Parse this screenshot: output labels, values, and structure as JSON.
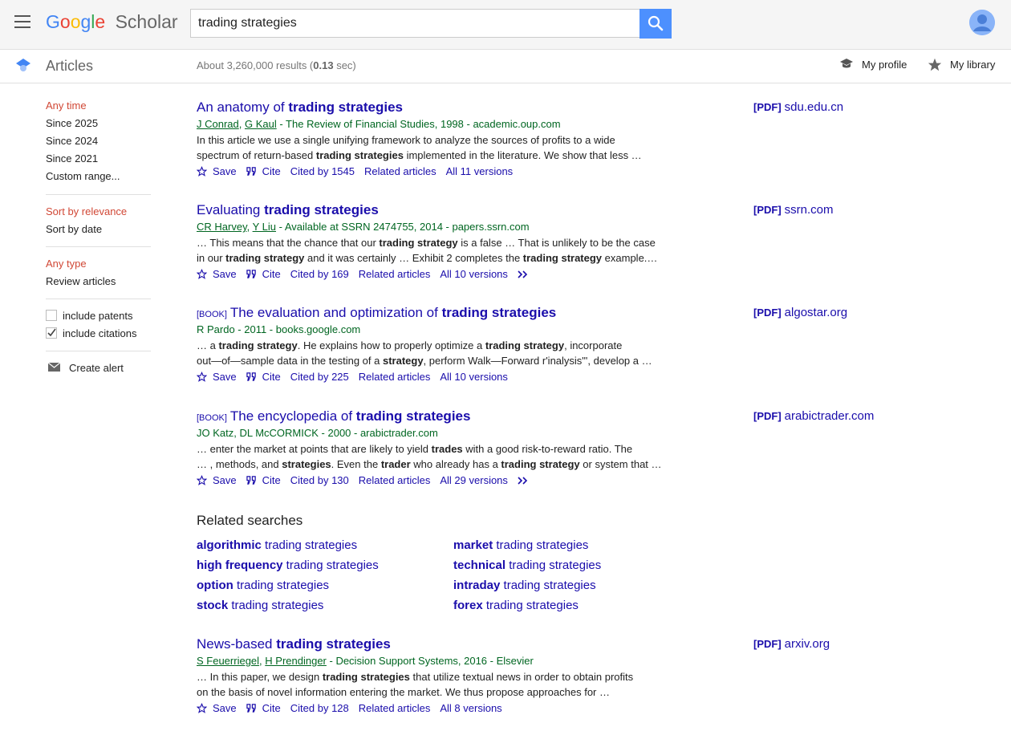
{
  "header": {
    "logo_text": "Google",
    "logo_suffix": "Scholar",
    "search_value": "trading strategies",
    "search_placeholder": "Search"
  },
  "subheader": {
    "section_label": "Articles",
    "results_prefix": "About 3,260,000 results (",
    "results_time": "0.13",
    "results_suffix": " sec)",
    "my_profile": "My profile",
    "my_library": "My library"
  },
  "sidebar": {
    "time_selected": "Any time",
    "time_options": [
      "Since 2025",
      "Since 2024",
      "Since 2021",
      "Custom range..."
    ],
    "sort_selected": "Sort by relevance",
    "sort_option": "Sort by date",
    "type_selected": "Any type",
    "type_option": "Review articles",
    "include_patents": "include patents",
    "include_citations": "include citations",
    "create_alert": "Create alert"
  },
  "results": [
    {
      "title_pre": "An anatomy of ",
      "title_bold": "trading strategies",
      "book": "",
      "meta_authors": [
        "J Conrad",
        "G Kaul"
      ],
      "meta_rest": " - The Review of Financial Studies, 1998 - academic.oup.com",
      "snippet_l1": "In this article we use a single unifying framework to analyze the sources of profits to a wide",
      "snippet_l2_pre": "spectrum of return-based ",
      "snippet_l2_bold": "trading strategies",
      "snippet_l2_post": " implemented in the literature. We show that less …",
      "save": "Save",
      "cite": "Cite",
      "cited_by": "Cited by 1545",
      "related": "Related articles",
      "versions": "All 11 versions",
      "pdf_tag": "[PDF]",
      "pdf_domain": "sdu.edu.cn"
    },
    {
      "title_pre": "Evaluating ",
      "title_bold": "trading strategies",
      "book": "",
      "meta_authors": [
        "CR Harvey",
        "Y Liu"
      ],
      "meta_rest": " - Available at SSRN 2474755, 2014 - papers.ssrn.com",
      "snippet_l1_a": "… This means that the chance that our ",
      "snippet_l1_b": "trading strategy",
      "snippet_l1_c": " is a false … That is unlikely to be the case",
      "snippet_l2_a": "in our ",
      "snippet_l2_b": "trading strategy",
      "snippet_l2_c": " and it was certainly … Exhibit 2 completes the ",
      "snippet_l2_d": "trading strategy",
      "snippet_l2_e": " example.…",
      "save": "Save",
      "cite": "Cite",
      "cited_by": "Cited by 169",
      "related": "Related articles",
      "versions": "All 10 versions",
      "pdf_tag": "[PDF]",
      "pdf_domain": "ssrn.com"
    },
    {
      "title_pre": "The evaluation and optimization of ",
      "title_bold": "trading strategies",
      "book": "[BOOK]",
      "meta_text": "R Pardo - 2011 - books.google.com",
      "snippet_l1_a": "… a ",
      "snippet_l1_b": "trading strategy",
      "snippet_l1_c": ". He explains how to properly optimize a ",
      "snippet_l1_d": "trading strategy",
      "snippet_l1_e": ", incorporate",
      "snippet_l2_a": "out—of—sample data in the testing of a ",
      "snippet_l2_b": "strategy",
      "snippet_l2_c": ", perform Walk—Forward r'inalysis\"', develop a …",
      "save": "Save",
      "cite": "Cite",
      "cited_by": "Cited by 225",
      "related": "Related articles",
      "versions": "All 10 versions",
      "pdf_tag": "[PDF]",
      "pdf_domain": "algostar.org"
    },
    {
      "title_pre": "The encyclopedia of ",
      "title_bold": "trading strategies",
      "book": "[BOOK]",
      "meta_text": "JO Katz, DL McCORMICK - 2000 - arabictrader.com",
      "snippet_l1_a": "… enter the market at points that are likely to yield ",
      "snippet_l1_b": "trades",
      "snippet_l1_c": " with a good risk-to-reward ratio. The",
      "snippet_l2_a": "… , methods, and ",
      "snippet_l2_b": "strategies",
      "snippet_l2_c": ". Even the ",
      "snippet_l2_d": "trader",
      "snippet_l2_e": " who already has a ",
      "snippet_l2_f": "trading strategy",
      "snippet_l2_g": " or system that …",
      "save": "Save",
      "cite": "Cite",
      "cited_by": "Cited by 130",
      "related": "Related articles",
      "versions": "All 29 versions",
      "pdf_tag": "[PDF]",
      "pdf_domain": "arabictrader.com"
    },
    {
      "title_pre": "News-based ",
      "title_bold": "trading strategies",
      "book": "",
      "meta_authors": [
        "S Feuerriegel",
        "H Prendinger"
      ],
      "meta_rest": " - Decision Support Systems, 2016 - Elsevier",
      "snippet_l1_a": "… In this paper, we design ",
      "snippet_l1_b": "trading strategies",
      "snippet_l1_c": " that utilize textual news in order to obtain profits",
      "snippet_l2": "on the basis of novel information entering the market. We thus propose approaches for …",
      "save": "Save",
      "cite": "Cite",
      "cited_by": "Cited by 128",
      "related": "Related articles",
      "versions": "All 8 versions",
      "pdf_tag": "[PDF]",
      "pdf_domain": "arxiv.org"
    }
  ],
  "related_searches": {
    "heading": "Related searches",
    "suffix": " trading strategies",
    "left": [
      "algorithmic",
      "high frequency",
      "option",
      "stock"
    ],
    "right": [
      "market",
      "technical",
      "intraday",
      "forex"
    ]
  },
  "colors": {
    "link": "#1a0dab",
    "meta": "#006621",
    "selected_filter": "#d14836",
    "search_button": "#4d90fe"
  }
}
